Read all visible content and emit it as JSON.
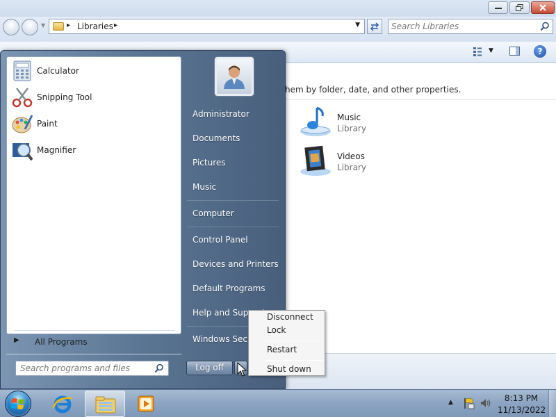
{
  "window": {
    "address": {
      "location": "Libraries"
    },
    "search": {
      "placeholder": "Search Libraries"
    },
    "content": {
      "description": "hem by folder, date, and other properties.",
      "libraries": [
        {
          "name": "Music",
          "type": "Library"
        },
        {
          "name": "Videos",
          "type": "Library"
        }
      ]
    }
  },
  "start_menu": {
    "programs": [
      {
        "label": "Calculator",
        "icon": "calculator-icon"
      },
      {
        "label": "Snipping Tool",
        "icon": "scissors-icon"
      },
      {
        "label": "Paint",
        "icon": "paint-palette-icon"
      },
      {
        "label": "Magnifier",
        "icon": "magnifier-icon"
      }
    ],
    "all_programs": "All Programs",
    "search_placeholder": "Search programs and files",
    "right_items": [
      "Administrator",
      "Documents",
      "Pictures",
      "Music",
      "Computer",
      "Control Panel",
      "Devices and Printers",
      "Default Programs",
      "Help and Support",
      "Windows Security"
    ],
    "logoff_label": "Log off"
  },
  "power_menu": {
    "items": [
      "Disconnect",
      "Lock",
      "Restart",
      "Shut down"
    ]
  },
  "taskbar": {
    "apps": [
      "internet-explorer-icon",
      "windows-explorer-icon",
      "media-player-icon"
    ],
    "clock": {
      "time": "8:13 PM",
      "date": "11/13/2022"
    }
  },
  "colors": {
    "start_menu_panel": "#5a7593",
    "taskbar": "#8ea6c3",
    "window_frame": "#dfe9f5"
  }
}
